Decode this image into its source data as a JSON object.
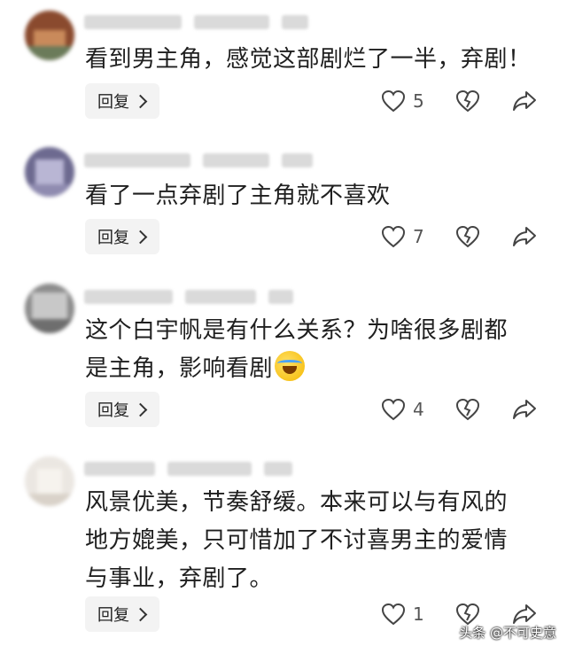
{
  "comments": [
    {
      "text": "看到男主角，感觉这部剧烂了一半，弃剧！",
      "reply_label": "回复",
      "likes": "5",
      "avatar_colors": [
        "#8a4a2e",
        "#c98a5b",
        "#6b7b5a"
      ]
    },
    {
      "text": "看了一点弃剧了主角就不喜欢",
      "reply_label": "回复",
      "likes": "7",
      "avatar_colors": [
        "#6d6a90",
        "#b9b6d4",
        "#8f8bb0"
      ]
    },
    {
      "text": "这个白宇帆是有什么关系？为啥很多剧都\n是主角，影响看剧",
      "reply_label": "回复",
      "likes": "4",
      "avatar_colors": [
        "#8c8c8c",
        "#c8c8c8",
        "#6e6e6e"
      ]
    },
    {
      "text": "风景优美，节奏舒缓。本来可以与有风的\n地方媲美，只可惜加了不讨喜男主的爱情\n与事业，弃剧了。",
      "reply_label": "回复",
      "likes": "1",
      "avatar_colors": [
        "#e8e4df",
        "#f2efea",
        "#d9d2c9"
      ]
    }
  ],
  "watermark": "头条 @不可史意",
  "colors": {
    "icon": "#444444",
    "reply_bg": "#f3f3f3"
  }
}
